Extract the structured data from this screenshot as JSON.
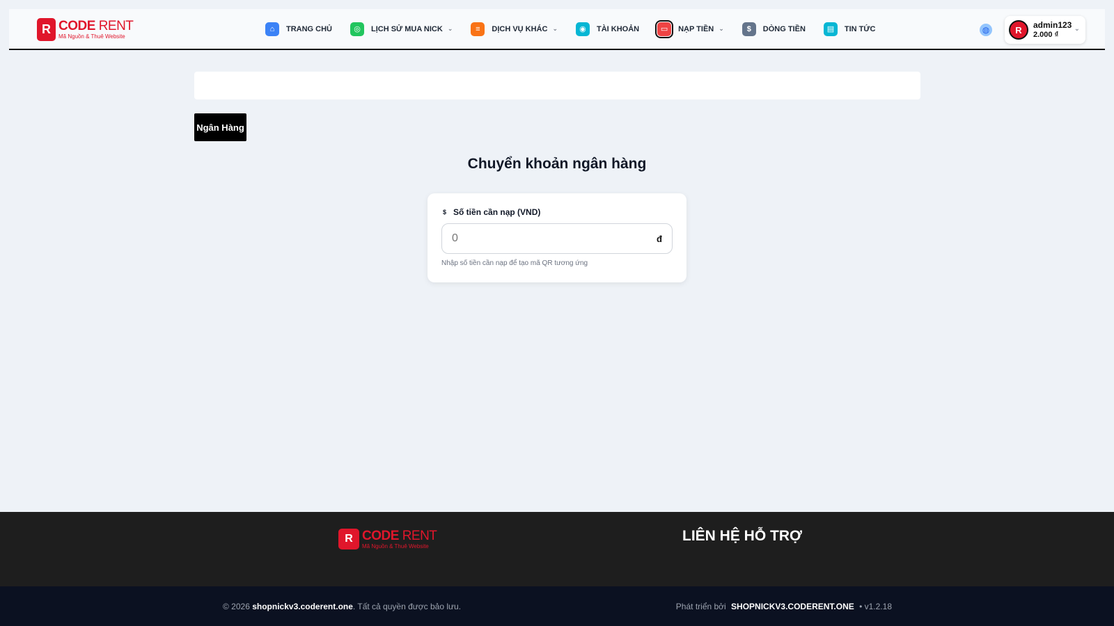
{
  "brand": {
    "logo_mark": "R",
    "name_part1": "CODE",
    "name_part2": "RENT",
    "tagline": "Mã Nguồn & Thuê Website"
  },
  "nav": {
    "items": [
      {
        "label": "TRANG CHỦ",
        "icon": "home-icon",
        "color": "#3b82f6",
        "glyph": "⌂",
        "caret": false
      },
      {
        "label": "LỊCH SỬ MUA NICK",
        "icon": "gamepad-icon",
        "color": "#22c55e",
        "glyph": "◎",
        "caret": true
      },
      {
        "label": "DỊCH VỤ KHÁC",
        "icon": "layers-icon",
        "color": "#f97316",
        "glyph": "≡",
        "caret": true
      },
      {
        "label": "TÀI KHOẢN",
        "icon": "user-icon",
        "color": "#06b6d4",
        "glyph": "◉",
        "caret": false
      },
      {
        "label": "NẠP TIỀN",
        "icon": "wallet-icon",
        "color": "#ef4444",
        "glyph": "▭",
        "caret": true,
        "active": true
      },
      {
        "label": "DÒNG TIỀN",
        "icon": "dollar-icon",
        "color": "#64748b",
        "glyph": "$",
        "caret": false
      },
      {
        "label": "TIN TỨC",
        "icon": "news-icon",
        "color": "#06b6d4",
        "glyph": "▤",
        "caret": false
      }
    ]
  },
  "user": {
    "name": "admin123",
    "balance": "2.000 ₫"
  },
  "content": {
    "tab_label": "Ngân Hàng",
    "section_title": "Chuyển khoản ngân hàng",
    "field_label": "Số tiền cần nạp (VND)",
    "amount_placeholder": "0",
    "currency_symbol": "đ",
    "hint": "Nhập số tiền cần nạp để tạo mã QR tương ứng"
  },
  "footer": {
    "contact_title": "LIÊN HỆ HỖ TRỢ",
    "copyright_prefix": "© 2026",
    "copyright_site": "shopnickv3.coderent.one",
    "copyright_suffix": ". Tất cả quyền được bảo lưu.",
    "dev_prefix": "Phát triển bởi",
    "dev_name": "SHOPNICKV3.CODERENT.ONE",
    "version": "• v1.2.18"
  }
}
